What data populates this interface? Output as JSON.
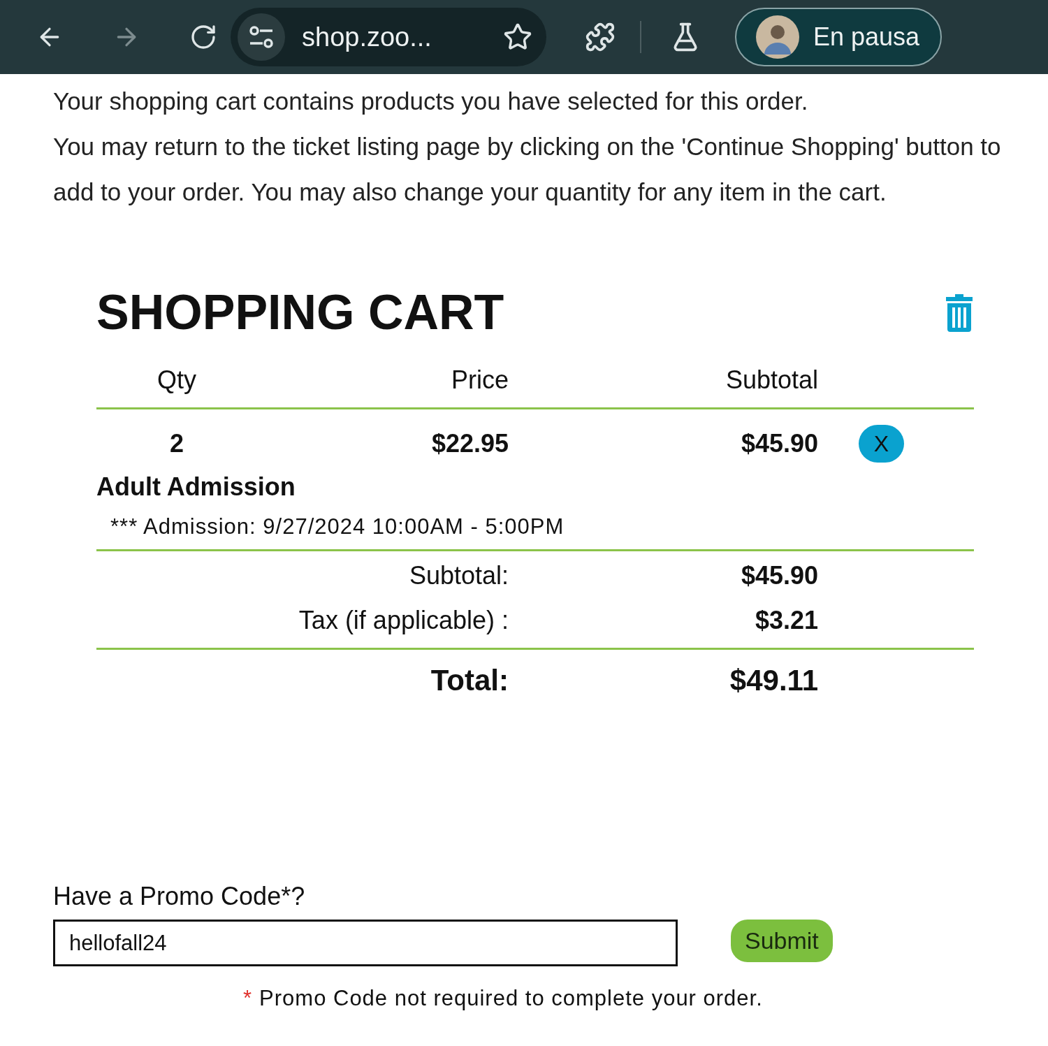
{
  "browser": {
    "forward_disabled": true,
    "url": "shop.zoo...",
    "profile_status": "En pausa"
  },
  "intro": [
    "Your shopping cart contains products you have selected for this order.",
    "You may return to the ticket listing page by clicking on the 'Continue Shopping' button to add to your order. You may also change your quantity for any item in the cart."
  ],
  "cart": {
    "title": "SHOPPING CART",
    "columns": [
      "Qty",
      "Price",
      "Subtotal"
    ],
    "items": [
      {
        "qty": "2",
        "price": "$22.95",
        "subtotal": "$45.90",
        "remove": "X",
        "name": "Adult Admission",
        "detail": "*** Admission: 9/27/2024 10:00AM - 5:00PM"
      }
    ],
    "summary": [
      {
        "label": "Subtotal:",
        "value": "$45.90"
      },
      {
        "label": "Tax (if applicable) :",
        "value": "$3.21"
      }
    ],
    "total": {
      "label": "Total:",
      "value": "$49.11"
    }
  },
  "promo": {
    "label": "Have a Promo Code*?",
    "value": "hellofall24",
    "button": "Submit",
    "note_mark": "*",
    "note": "Promo Code not required to complete your order."
  }
}
